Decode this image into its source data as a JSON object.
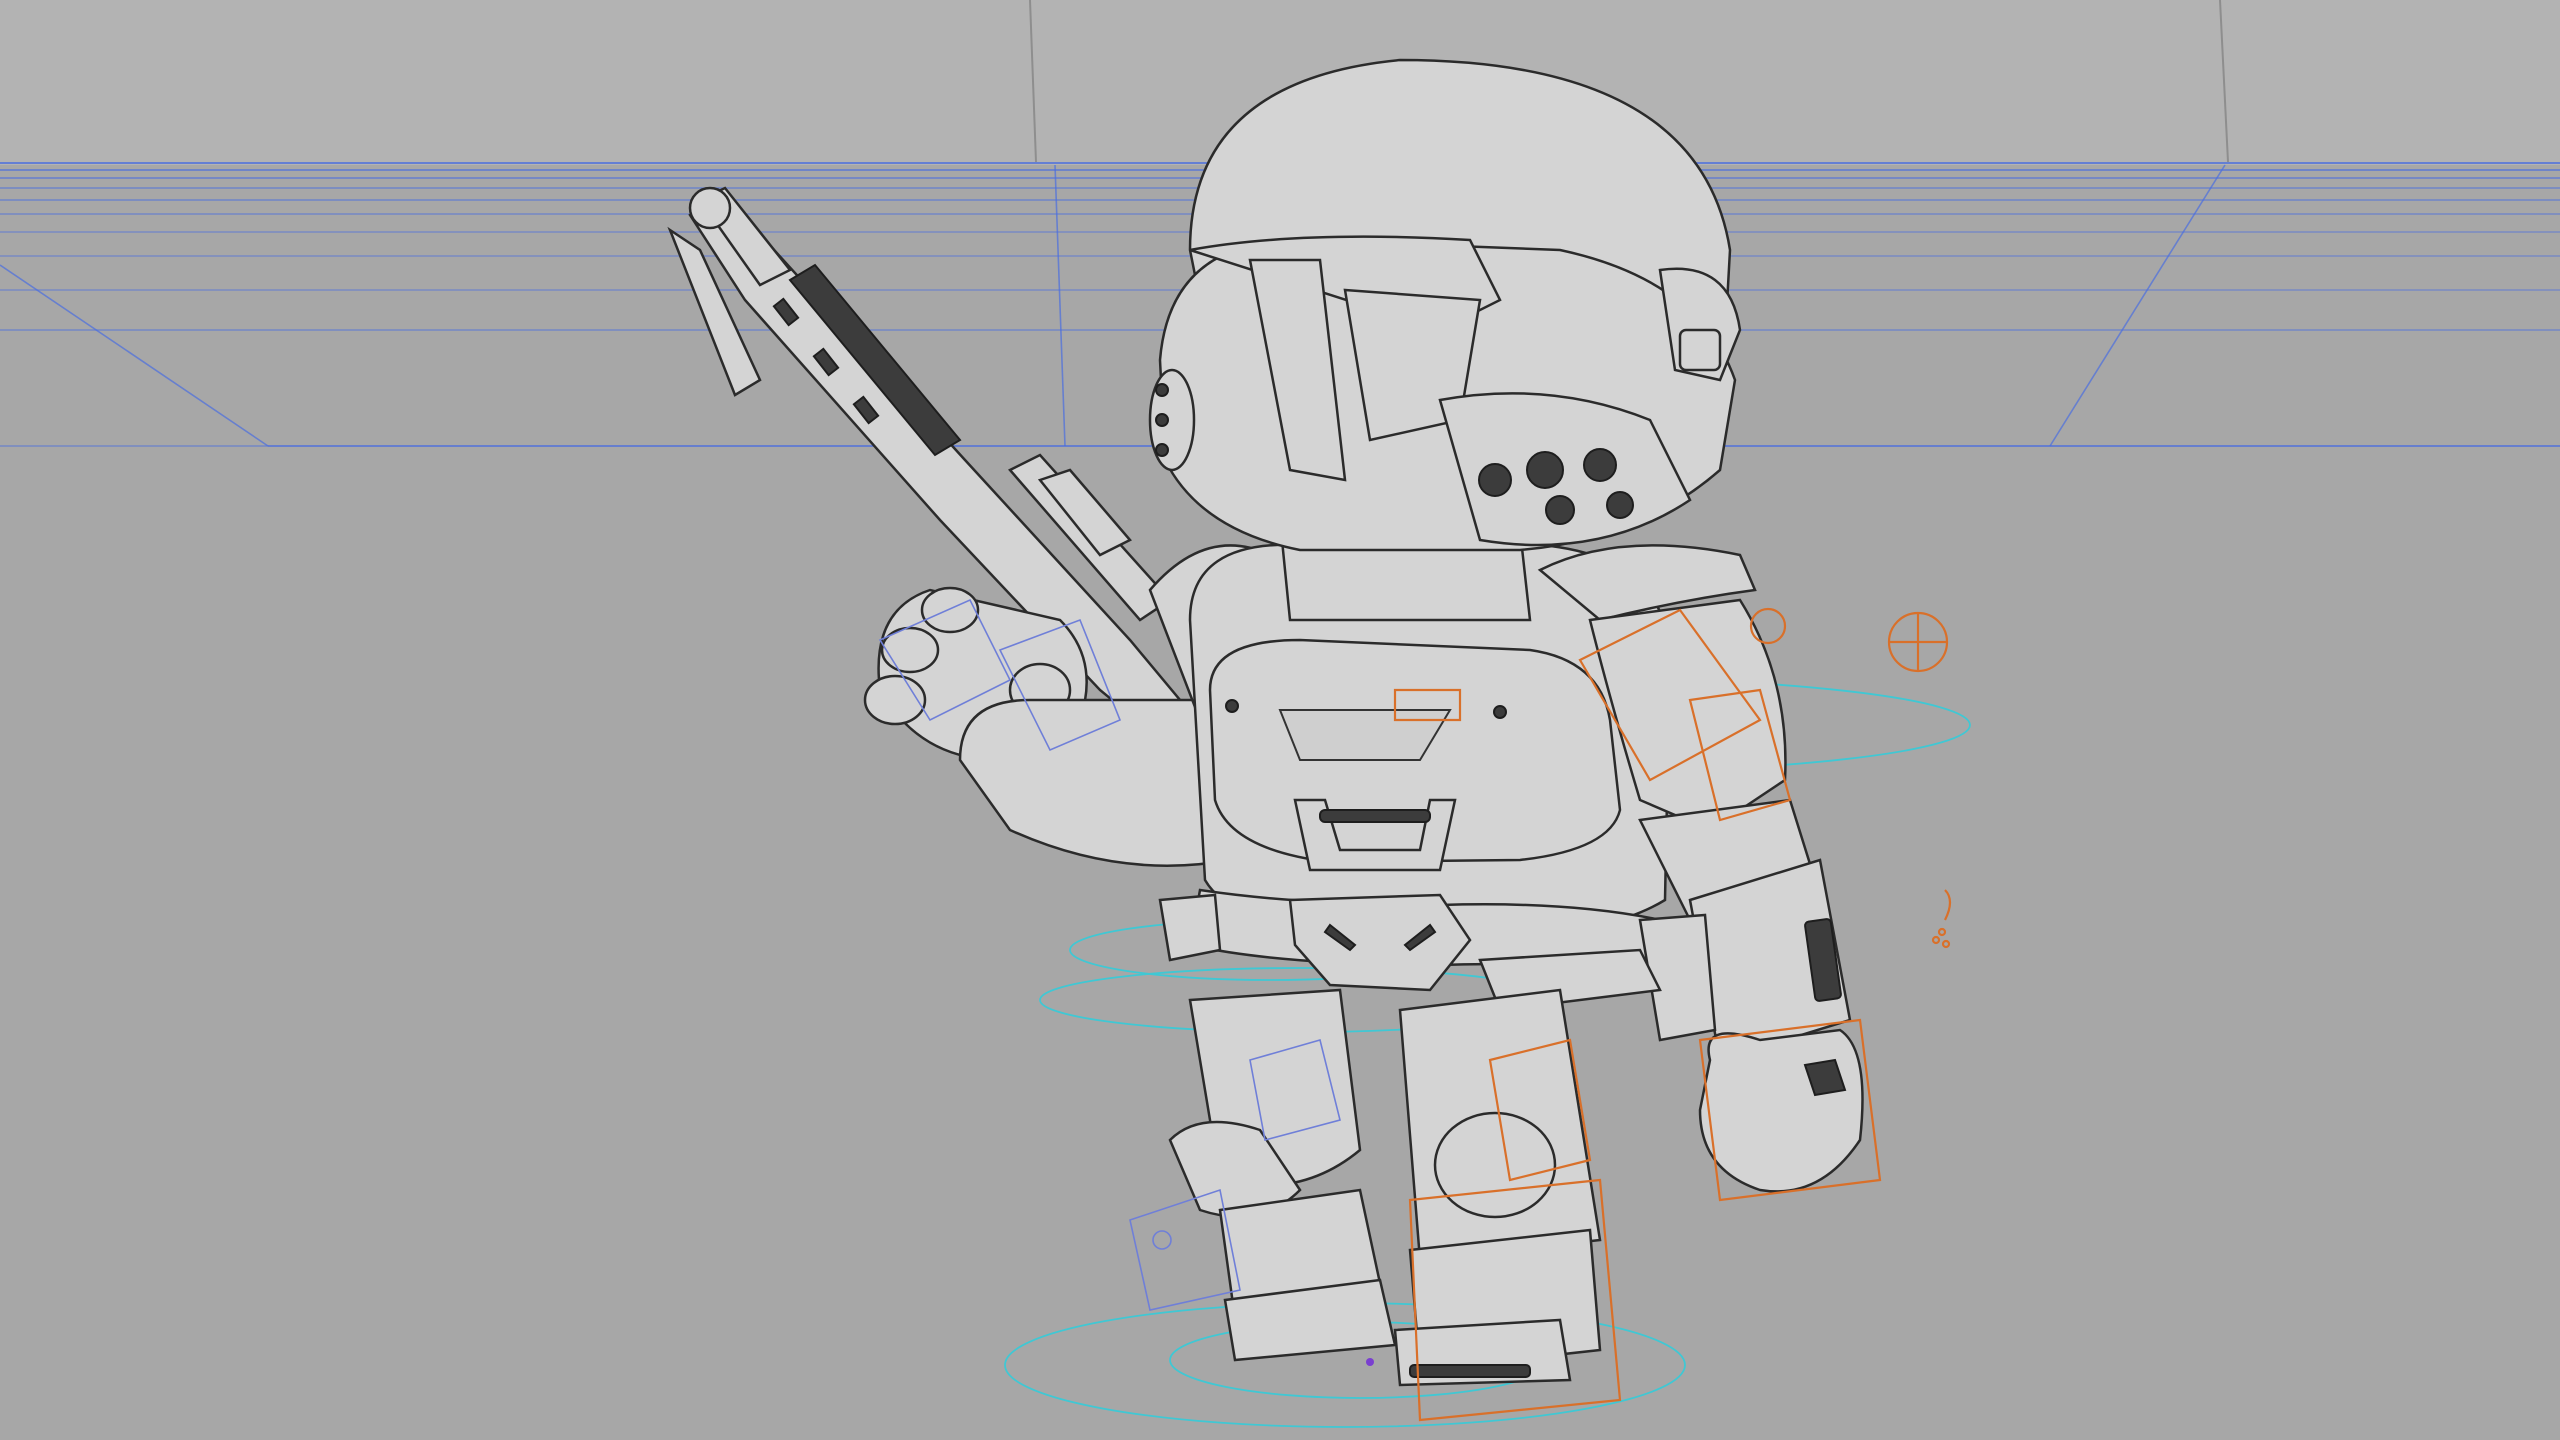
{
  "viewport": {
    "mode": "wireframe-on-shaded",
    "subject": "chibi-armored-soldier-rig"
  },
  "colors": {
    "background": "#a7a7a7",
    "mesh_fill": "#d4d4d4",
    "wire": "#2b2b2b",
    "guide_lines": "#4a6ee0",
    "rig_controls_orange": "#d9702a",
    "rig_controls_cyan": "#3fc8d4",
    "rig_controls_blue": "#6f7fd8"
  }
}
